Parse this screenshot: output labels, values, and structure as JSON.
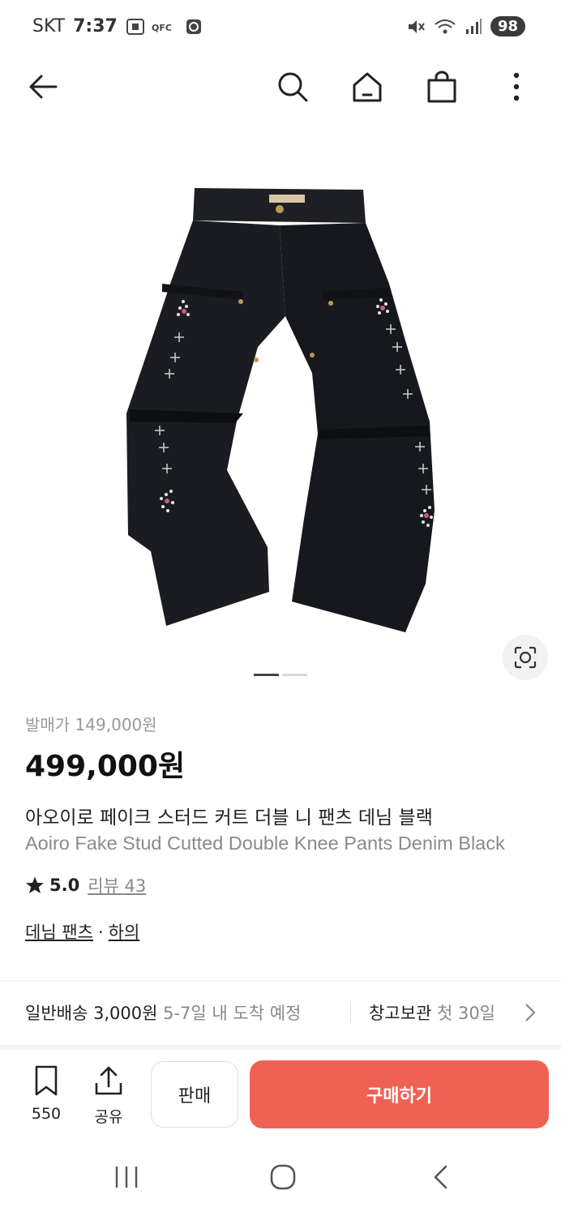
{
  "status_bar": {
    "carrier": "SKT",
    "time": "7:37",
    "battery": "98"
  },
  "nav": {
    "icons": [
      "back-arrow-icon",
      "search-icon",
      "home-icon",
      "shopping-bag-icon",
      "more-vertical-icon"
    ]
  },
  "product": {
    "image_icon": "pants-image",
    "release_price": "발매가 149,000원",
    "price": "499,000원",
    "title_ko": "아오이로 페이크 스터드 커트 더블 니 팬츠 데님 블랙",
    "title_en": "Aoiro Fake Stud Cutted Double Knee Pants Denim Black",
    "rating": "5.0",
    "review_label": "리뷰 43",
    "category": "데님 팬츠",
    "category_sep": "·",
    "subcategory": "하의",
    "carousel": {
      "count": 2,
      "active": 0
    }
  },
  "shipping": {
    "label": "일반배송 3,000원",
    "eta": "5-7일 내 도착 예정",
    "storage_label": "창고보관",
    "storage_note": "첫 30일"
  },
  "actions": {
    "bookmark_count": "550",
    "share_label": "공유",
    "sell_label": "판매",
    "buy_label": "구매하기"
  },
  "colors": {
    "buy_button": "#ef6253",
    "price_muted": "#9a9a9a"
  }
}
